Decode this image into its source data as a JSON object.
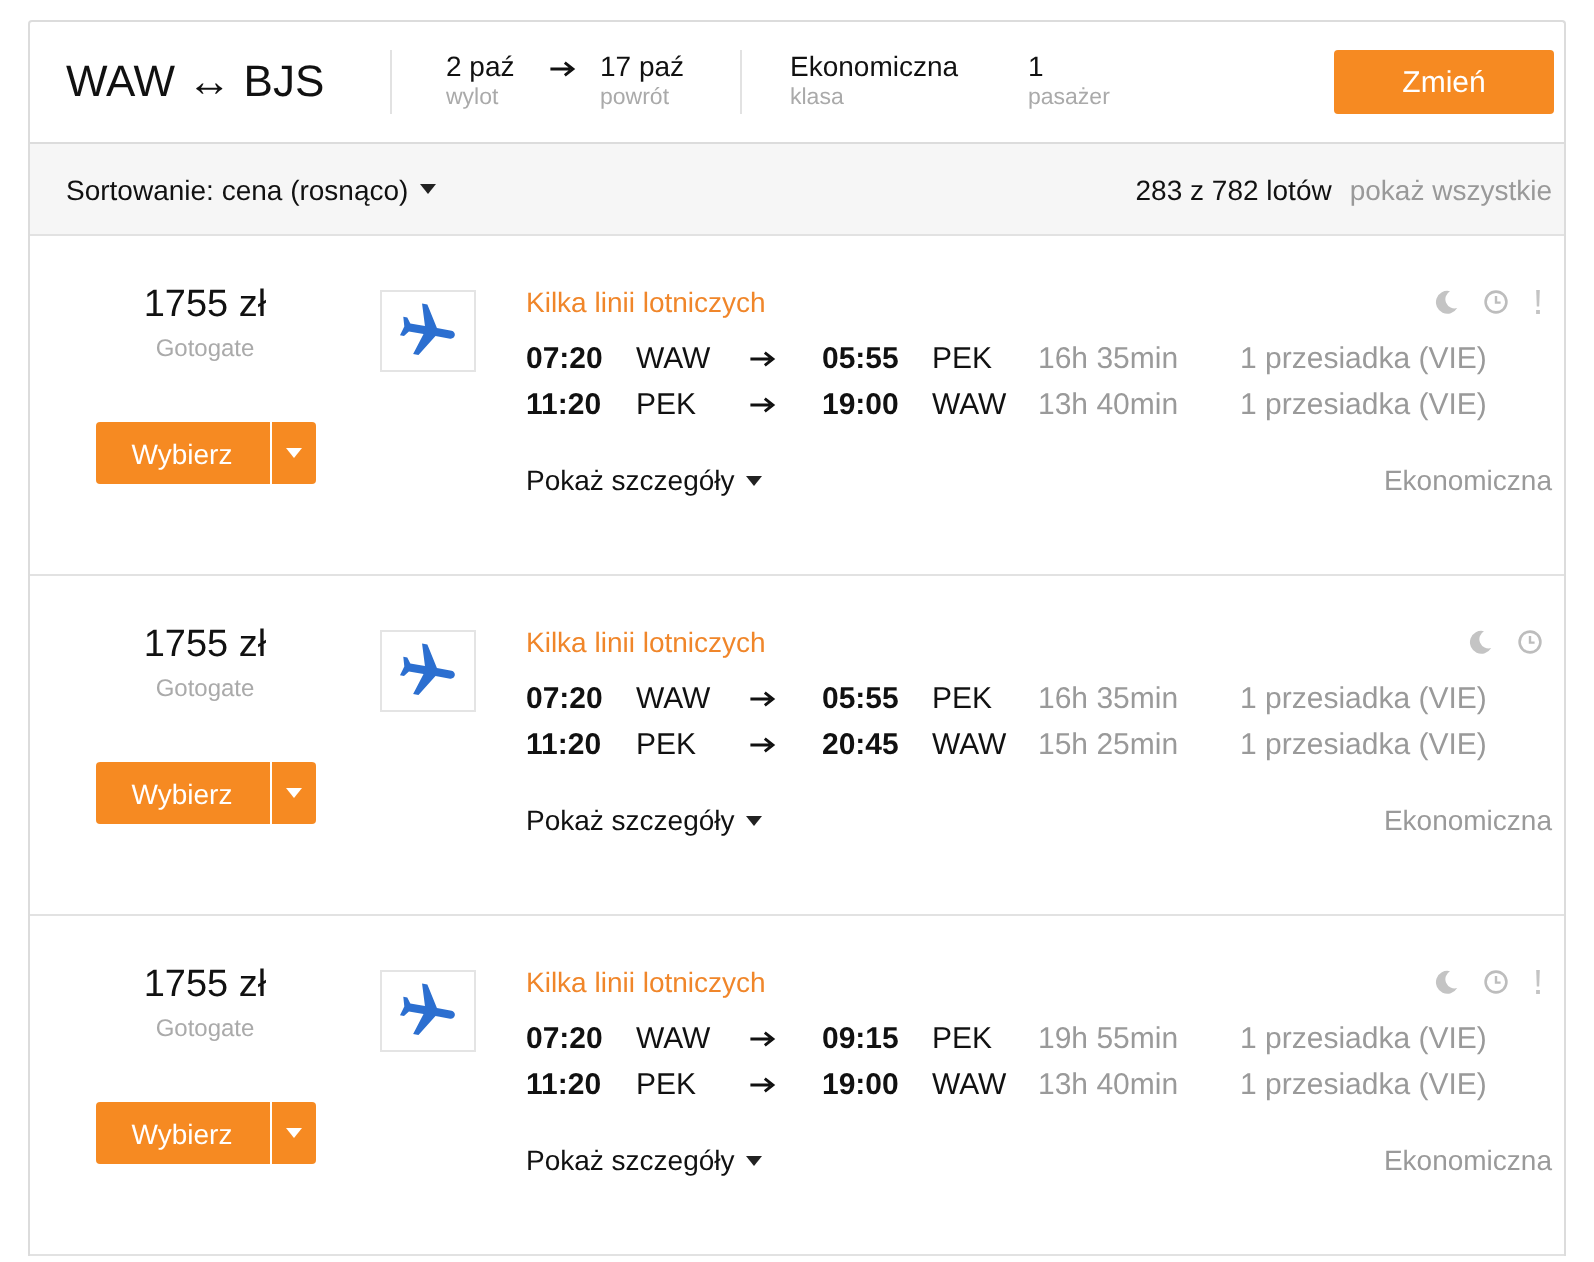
{
  "search_summary": {
    "route": "WAW ↔ BJS",
    "dates": [
      {
        "value": "2 paź",
        "label": "wylot"
      },
      {
        "value": "17 paź",
        "label": "powrót"
      }
    ],
    "cabin": {
      "value": "Ekonomiczna",
      "label": "klasa"
    },
    "passengers": {
      "value": "1",
      "label": "pasażer"
    },
    "change_button": "Zmień"
  },
  "sort_bar": {
    "sort_label": "Sortowanie: cena (rosnąco)",
    "result_count": "283 z 782 lotów",
    "show_all_link": "pokaż wszystkie"
  },
  "results": [
    {
      "price": "1755 zł",
      "provider": "Gotogate",
      "select_button": "Wybierz",
      "airline": "Kilka linii lotniczych",
      "flags": [
        {
          "kind": "moon"
        },
        {
          "kind": "clock"
        },
        {
          "kind": "alert"
        }
      ],
      "legs": [
        {
          "departure_time": "07:20",
          "departure_airport": "WAW",
          "arrival_time": "05:55",
          "arrival_airport": "PEK",
          "duration": "16h 35min",
          "stops": "1 przesiadka (VIE)"
        },
        {
          "departure_time": "11:20",
          "departure_airport": "PEK",
          "arrival_time": "19:00",
          "arrival_airport": "WAW",
          "duration": "13h 40min",
          "stops": "1 przesiadka (VIE)"
        }
      ],
      "details_link": "Pokaż szczegóły",
      "cabin": "Ekonomiczna"
    },
    {
      "price": "1755 zł",
      "provider": "Gotogate",
      "select_button": "Wybierz",
      "airline": "Kilka linii lotniczych",
      "flags": [
        {
          "kind": "moon"
        },
        {
          "kind": "clock"
        }
      ],
      "legs": [
        {
          "departure_time": "07:20",
          "departure_airport": "WAW",
          "arrival_time": "05:55",
          "arrival_airport": "PEK",
          "duration": "16h 35min",
          "stops": "1 przesiadka (VIE)"
        },
        {
          "departure_time": "11:20",
          "departure_airport": "PEK",
          "arrival_time": "20:45",
          "arrival_airport": "WAW",
          "duration": "15h 25min",
          "stops": "1 przesiadka (VIE)"
        }
      ],
      "details_link": "Pokaż szczegóły",
      "cabin": "Ekonomiczna"
    },
    {
      "price": "1755 zł",
      "provider": "Gotogate",
      "select_button": "Wybierz",
      "airline": "Kilka linii lotniczych",
      "flags": [
        {
          "kind": "moon"
        },
        {
          "kind": "clock"
        },
        {
          "kind": "alert"
        }
      ],
      "legs": [
        {
          "departure_time": "07:20",
          "departure_airport": "WAW",
          "arrival_time": "09:15",
          "arrival_airport": "PEK",
          "duration": "19h 55min",
          "stops": "1 przesiadka (VIE)"
        },
        {
          "departure_time": "11:20",
          "departure_airport": "PEK",
          "arrival_time": "19:00",
          "arrival_airport": "WAW",
          "duration": "13h 40min",
          "stops": "1 przesiadka (VIE)"
        }
      ],
      "details_link": "Pokaż szczegóły",
      "cabin": "Ekonomiczna"
    }
  ]
}
